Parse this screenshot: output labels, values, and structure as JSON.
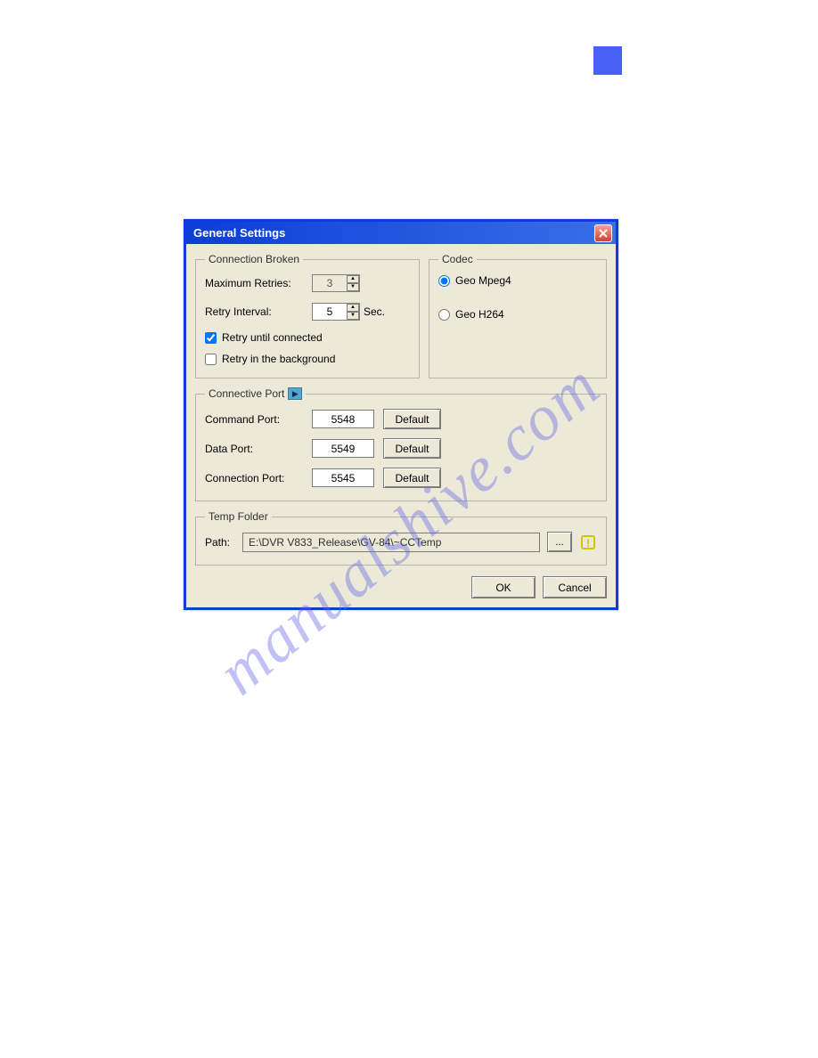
{
  "decorations": {
    "watermark": "manualshive.com"
  },
  "dialog": {
    "title": "General Settings",
    "connection_broken": {
      "legend": "Connection Broken",
      "max_retries_label": "Maximum Retries:",
      "max_retries": "3",
      "retry_interval_label": "Retry Interval:",
      "retry_interval": "5",
      "sec_label": "Sec.",
      "retry_until_label": "Retry until connected",
      "retry_until_checked": true,
      "retry_background_label": "Retry in the background",
      "retry_background_checked": false
    },
    "codec": {
      "legend": "Codec",
      "option_mpeg4": "Geo Mpeg4",
      "option_h264": "Geo H264",
      "selected": "mpeg4"
    },
    "connective_port": {
      "legend": "Connective Port",
      "command_port_label": "Command Port:",
      "command_port": "5548",
      "data_port_label": "Data Port:",
      "data_port": "5549",
      "connection_port_label": "Connection Port:",
      "connection_port": "5545",
      "default_label": "Default"
    },
    "temp_folder": {
      "legend": "Temp Folder",
      "path_label": "Path:",
      "path_value": "E:\\DVR V833_Release\\GV-84\\~CCTemp",
      "browse_label": "..."
    },
    "buttons": {
      "ok": "OK",
      "cancel": "Cancel"
    }
  }
}
